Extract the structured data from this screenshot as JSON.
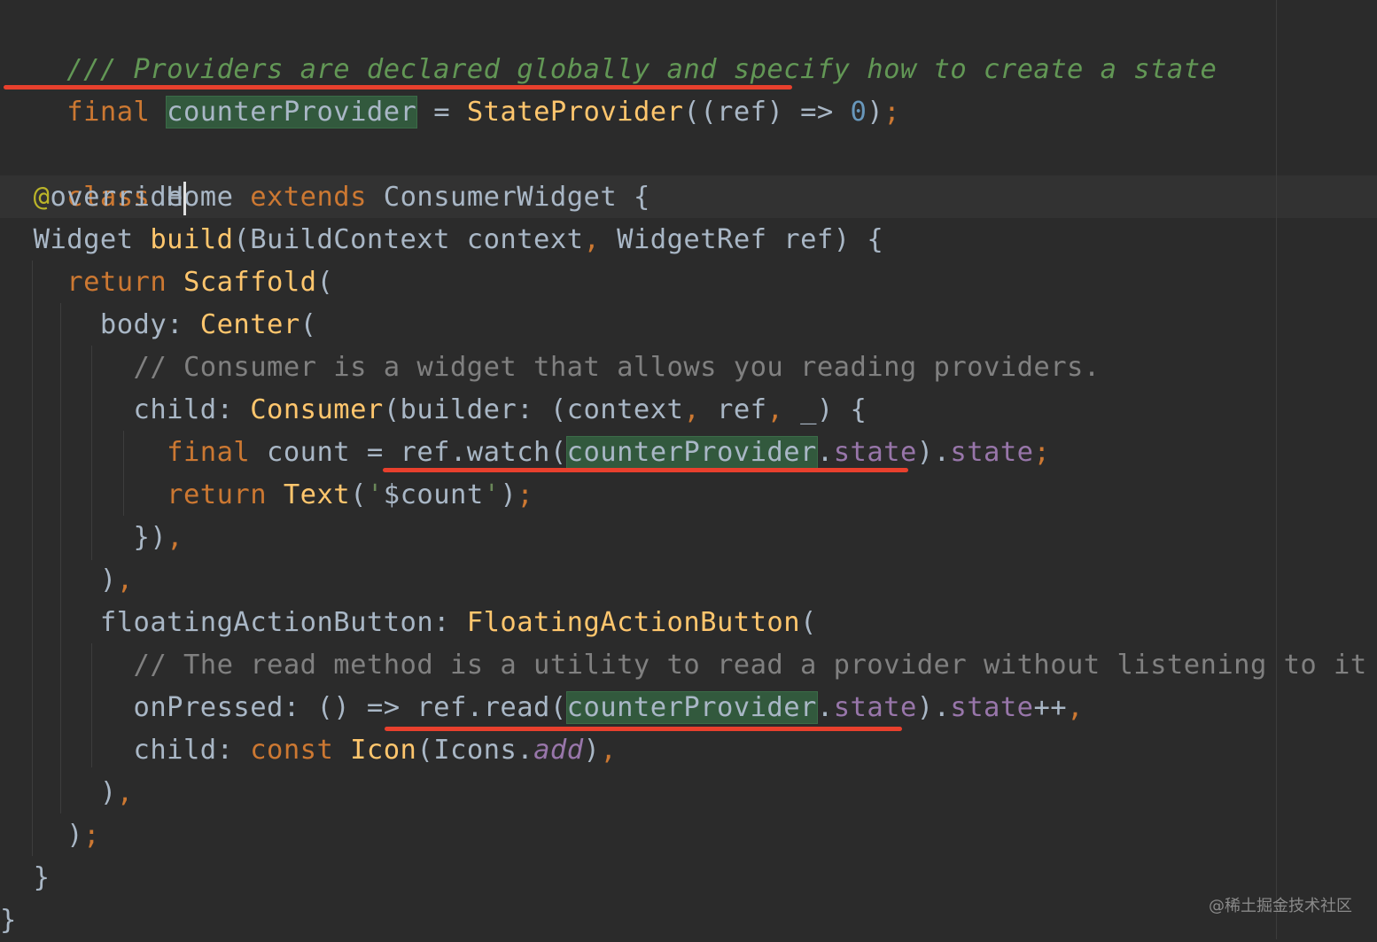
{
  "lines": [
    "/// Providers are declared globally and specify how to create a state",
    "final counterProvider = StateProvider((ref) => 0);",
    "",
    "class Home extends ConsumerWidget {",
    "  @override",
    "  Widget build(BuildContext context, WidgetRef ref) {",
    "    return Scaffold(",
    "      body: Center(",
    "        // Consumer is a widget that allows you reading providers.",
    "        child: Consumer(builder: (context, ref, _) {",
    "          final count = ref.watch(counterProvider.state).state;",
    "          return Text('$count');",
    "        }),",
    "      ),",
    "      floatingActionButton: FloatingActionButton(",
    "        // The read method is a utility to read a provider without listening to it",
    "        onPressed: () => ref.read(counterProvider.state).state++,",
    "        child: const Icon(Icons.add),",
    "      ),",
    "    );",
    "  }",
    "}"
  ],
  "tokens": {
    "l0_comment": "/// Providers are declared globally and specify how to create a state",
    "l1_final": "final",
    "l1_name": "counterProvider",
    "l1_eq": " = ",
    "l1_fn": "StateProvider",
    "l1_args": "((ref) => ",
    "l1_num": "0",
    "l1_close": ")",
    "l1_semi": ";",
    "l3_class": "class",
    "l3_home": " Home ",
    "l3_extends": "extends",
    "l3_rest": " ConsumerWidget {",
    "l4_at": "@",
    "l4_override": "override",
    "l5_widget": "Widget ",
    "l5_build": "build",
    "l5_params1": "(BuildContext context",
    "l5_comma": ",",
    "l5_params2": " WidgetRef ref) {",
    "l6_return": "return ",
    "l6_scaffold": "Scaffold",
    "l6_paren": "(",
    "l7_body": "body: ",
    "l7_center": "Center",
    "l7_paren": "(",
    "l8_comment": "// Consumer is a widget that allows you reading providers.",
    "l9_child": "child: ",
    "l9_consumer": "Consumer",
    "l9_args1": "(builder: (context",
    "l9_c1": ",",
    "l9_ref": " ref",
    "l9_c2": ",",
    "l9_rest": " _) {",
    "l10_final": "final ",
    "l10_count": "count = ref.watch(",
    "l10_name": "counterProvider",
    "l10_dot1": ".",
    "l10_state1": "state",
    "l10_close": ").",
    "l10_state2": "state",
    "l10_semi": ";",
    "l11_return": "return ",
    "l11_text": "Text",
    "l11_open": "(",
    "l11_q1": "'",
    "l11_var": "$count",
    "l11_q2": "'",
    "l11_close": ")",
    "l11_semi": ";",
    "l12_close": "})",
    "l12_comma": ",",
    "l13_close": ")",
    "l13_comma": ",",
    "l14_fab": "floatingActionButton: ",
    "l14_fabfn": "FloatingActionButton",
    "l14_paren": "(",
    "l15_comment": "// The read method is a utility to read a provider without listening to it",
    "l16_onpressed": "onPressed: () => ref.read(",
    "l16_name": "counterProvider",
    "l16_dot1": ".",
    "l16_state1": "state",
    "l16_close": ").",
    "l16_state2": "state",
    "l16_incr": "++",
    "l16_comma": ",",
    "l17_child": "child: ",
    "l17_const": "const ",
    "l17_icon": "Icon",
    "l17_icons": "(Icons.",
    "l17_add": "add",
    "l17_close": ")",
    "l17_comma": ",",
    "l18_close": ")",
    "l18_comma": ",",
    "l19_close": ")",
    "l19_semi": ";",
    "l20_brace": "}",
    "l21_brace": "}"
  },
  "watermark": "@稀土掘金技术社区",
  "colors": {
    "background": "#2b2b2b",
    "current_line": "#323232",
    "keyword": "#cc7832",
    "function": "#ffc66d",
    "doc_comment": "#629755",
    "comment": "#808080",
    "field": "#9876aa",
    "number": "#6897bb",
    "string": "#6a8759",
    "annotation": "#bbb529",
    "usage_highlight": "#32593d",
    "annotation_underline": "#e8402d"
  }
}
